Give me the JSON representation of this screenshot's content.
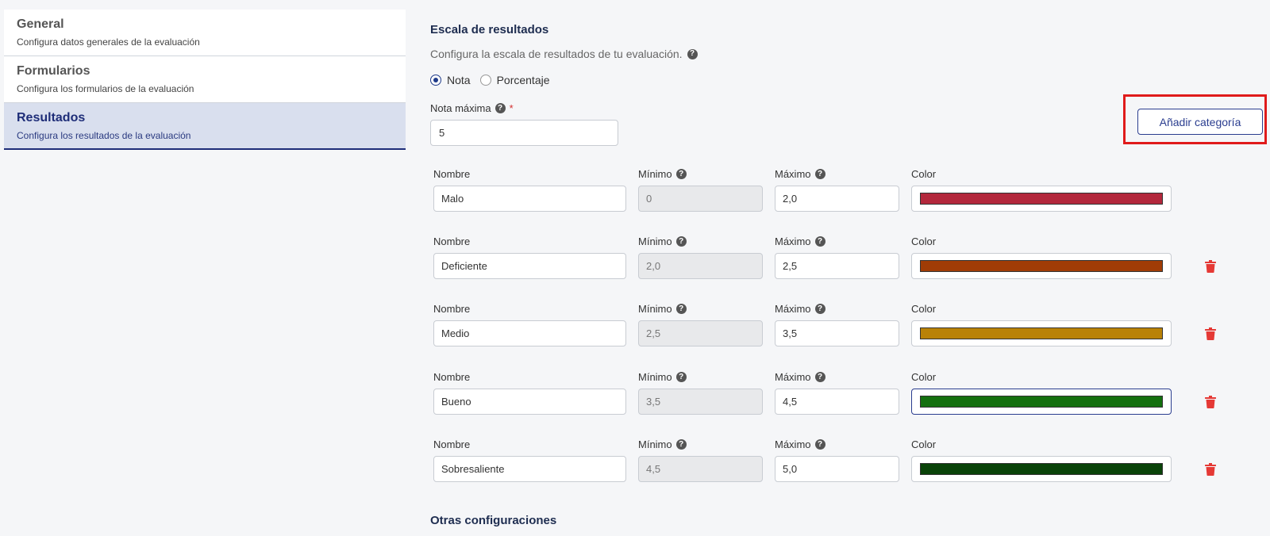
{
  "sidebar": {
    "items": [
      {
        "title": "General",
        "desc": "Configura datos generales de la evaluación"
      },
      {
        "title": "Formularios",
        "desc": "Configura los formularios de la evaluación"
      },
      {
        "title": "Resultados",
        "desc": "Configura los resultados de la evaluación"
      }
    ]
  },
  "main": {
    "title": "Escala de resultados",
    "desc": "Configura la escala de resultados de tu evaluación.",
    "radio_nota": "Nota",
    "radio_porcentaje": "Porcentaje",
    "max_label": "Nota máxima",
    "required": "*",
    "max_value": "5",
    "add_button": "Añadir categoría",
    "other_title": "Otras configuraciones"
  },
  "labels": {
    "nombre": "Nombre",
    "minimo": "Mínimo",
    "maximo": "Máximo",
    "color": "Color"
  },
  "help_icon": "?",
  "categories": [
    {
      "name": "Malo",
      "min": "0",
      "max": "2,0",
      "color": "#b3283c"
    },
    {
      "name": "Deficiente",
      "min": "2,0",
      "max": "2,5",
      "color": "#a03c06"
    },
    {
      "name": "Medio",
      "min": "2,5",
      "max": "3,5",
      "color": "#b98207"
    },
    {
      "name": "Bueno",
      "min": "3,5",
      "max": "4,5",
      "color": "#14700f"
    },
    {
      "name": "Sobresaliente",
      "min": "4,5",
      "max": "5,0",
      "color": "#0a4309"
    }
  ],
  "colors": {
    "accent": "#1e2d78",
    "delete": "#e53935",
    "highlight": "#e01b1b"
  }
}
